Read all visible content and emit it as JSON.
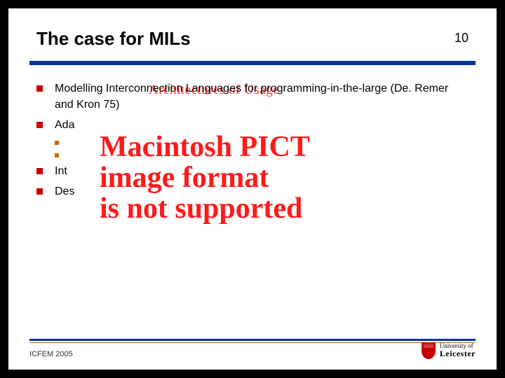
{
  "header": {
    "title": "The case for MILs",
    "page_number": "10"
  },
  "overlay": {
    "ownership_text": "Architectures of Usage"
  },
  "bullets": {
    "b1": "Modelling Interconnection Languages for programming-in-the-large (De. Remer and Kron 75)",
    "b2": "Ada",
    "b2a": "",
    "b2b": "",
    "b3": "Int",
    "b4": "Des"
  },
  "pict_error": {
    "line1": "Macintosh PICT",
    "line2": "image format",
    "line3": "is not supported"
  },
  "footer": {
    "conference": "ICFEM 2005",
    "university_line1": "University of",
    "university_line2": "Leicester"
  }
}
